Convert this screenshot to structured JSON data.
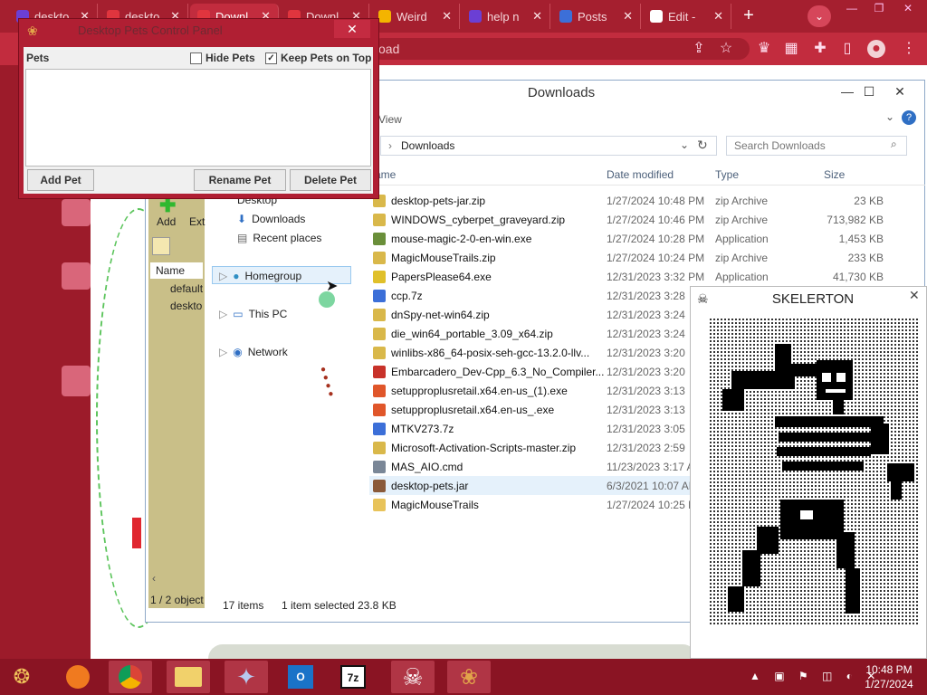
{
  "browser": {
    "tabs": [
      {
        "label": "deskto",
        "fav_color": "#6b3fd4"
      },
      {
        "label": "deskto",
        "fav_color": "#e0353e"
      },
      {
        "label": "Downl",
        "fav_color": "#e0353e",
        "active": true
      },
      {
        "label": "Downl",
        "fav_color": "#e0353e"
      },
      {
        "label": "Weird",
        "fav_color": "#f4b400"
      },
      {
        "label": "help n",
        "fav_color": "#6b3fd4"
      },
      {
        "label": "Posts",
        "fav_color": "#3c6fd8"
      },
      {
        "label": "Edit -",
        "fav_color": "#ffffff"
      }
    ],
    "new_tab": "+",
    "omnibox_text": "oad"
  },
  "explorer": {
    "title": "Downloads",
    "view_tab": "View",
    "address": "Downloads",
    "search_placeholder": "Search Downloads",
    "columns": {
      "name": "ame",
      "date": "Date modified",
      "type": "Type",
      "size": "Size"
    },
    "nav": {
      "desktop": "Desktop",
      "downloads": "Downloads",
      "recent": "Recent places",
      "homegroup": "Homegroup",
      "thispc": "This PC",
      "network": "Network"
    },
    "left_pane": {
      "add": "Add",
      "ext": "Ext",
      "name_col": "Name",
      "item1": "default",
      "item2": "deskto",
      "count": "1 / 2 object"
    },
    "files": [
      {
        "name": "desktop-pets-jar.zip",
        "date": "1/27/2024 10:48 PM",
        "type": "zip Archive",
        "size": "23 KB",
        "icon": "#d9b84a"
      },
      {
        "name": "WINDOWS_cyberpet_graveyard.zip",
        "date": "1/27/2024 10:46 PM",
        "type": "zip Archive",
        "size": "713,982 KB",
        "icon": "#d9b84a"
      },
      {
        "name": "mouse-magic-2-0-en-win.exe",
        "date": "1/27/2024 10:28 PM",
        "type": "Application",
        "size": "1,453 KB",
        "icon": "#6a8f3a"
      },
      {
        "name": "MagicMouseTrails.zip",
        "date": "1/27/2024 10:24 PM",
        "type": "zip Archive",
        "size": "233 KB",
        "icon": "#d9b84a"
      },
      {
        "name": "PapersPlease64.exe",
        "date": "12/31/2023 3:32 PM",
        "type": "Application",
        "size": "41,730 KB",
        "icon": "#e0c02a"
      },
      {
        "name": "ccp.7z",
        "date": "12/31/2023 3:28",
        "type": "",
        "size": "",
        "icon": "#3c6fd8"
      },
      {
        "name": "dnSpy-net-win64.zip",
        "date": "12/31/2023 3:24",
        "type": "",
        "size": "",
        "icon": "#d9b84a"
      },
      {
        "name": "die_win64_portable_3.09_x64.zip",
        "date": "12/31/2023 3:24",
        "type": "",
        "size": "",
        "icon": "#d9b84a"
      },
      {
        "name": "winlibs-x86_64-posix-seh-gcc-13.2.0-llv...",
        "date": "12/31/2023 3:20",
        "type": "",
        "size": "",
        "icon": "#d9b84a"
      },
      {
        "name": "Embarcadero_Dev-Cpp_6.3_No_Compiler...",
        "date": "12/31/2023 3:20",
        "type": "",
        "size": "",
        "icon": "#c8322a"
      },
      {
        "name": "setupproplusretail.x64.en-us_(1).exe",
        "date": "12/31/2023 3:13",
        "type": "",
        "size": "",
        "icon": "#e0562a"
      },
      {
        "name": "setupproplusretail.x64.en-us_.exe",
        "date": "12/31/2023 3:13",
        "type": "",
        "size": "",
        "icon": "#e0562a"
      },
      {
        "name": "MTKV273.7z",
        "date": "12/31/2023 3:05",
        "type": "",
        "size": "",
        "icon": "#3c6fd8"
      },
      {
        "name": "Microsoft-Activation-Scripts-master.zip",
        "date": "12/31/2023 2:59",
        "type": "",
        "size": "",
        "icon": "#d9b84a"
      },
      {
        "name": "MAS_AIO.cmd",
        "date": "11/23/2023 3:17 A",
        "type": "",
        "size": "",
        "icon": "#7a8797"
      },
      {
        "name": "desktop-pets.jar",
        "date": "6/3/2021 10:07 AM",
        "type": "",
        "size": "",
        "icon": "#8a5a3a",
        "selected": true
      },
      {
        "name": "MagicMouseTrails",
        "date": "1/27/2024 10:25 P",
        "type": "",
        "size": "",
        "icon": "#e8c35a"
      }
    ],
    "status": {
      "items": "17 items",
      "selected": "1 item selected",
      "size": "23.8 KB"
    }
  },
  "pet_panel": {
    "title": "Desktop Pets Control Panel",
    "pets_label": "Pets",
    "hide_pets": "Hide Pets",
    "keep_on_top": "Keep Pets on Top",
    "add_pet": "Add Pet",
    "rename_pet": "Rename Pet",
    "delete_pet": "Delete Pet"
  },
  "skelerton": {
    "title": "SKELERTON"
  },
  "taskbar": {
    "time": "10:48 PM",
    "date": "1/27/2024"
  },
  "colors": {
    "accent": "#c22c3e",
    "taskbar": "#8a1423"
  }
}
